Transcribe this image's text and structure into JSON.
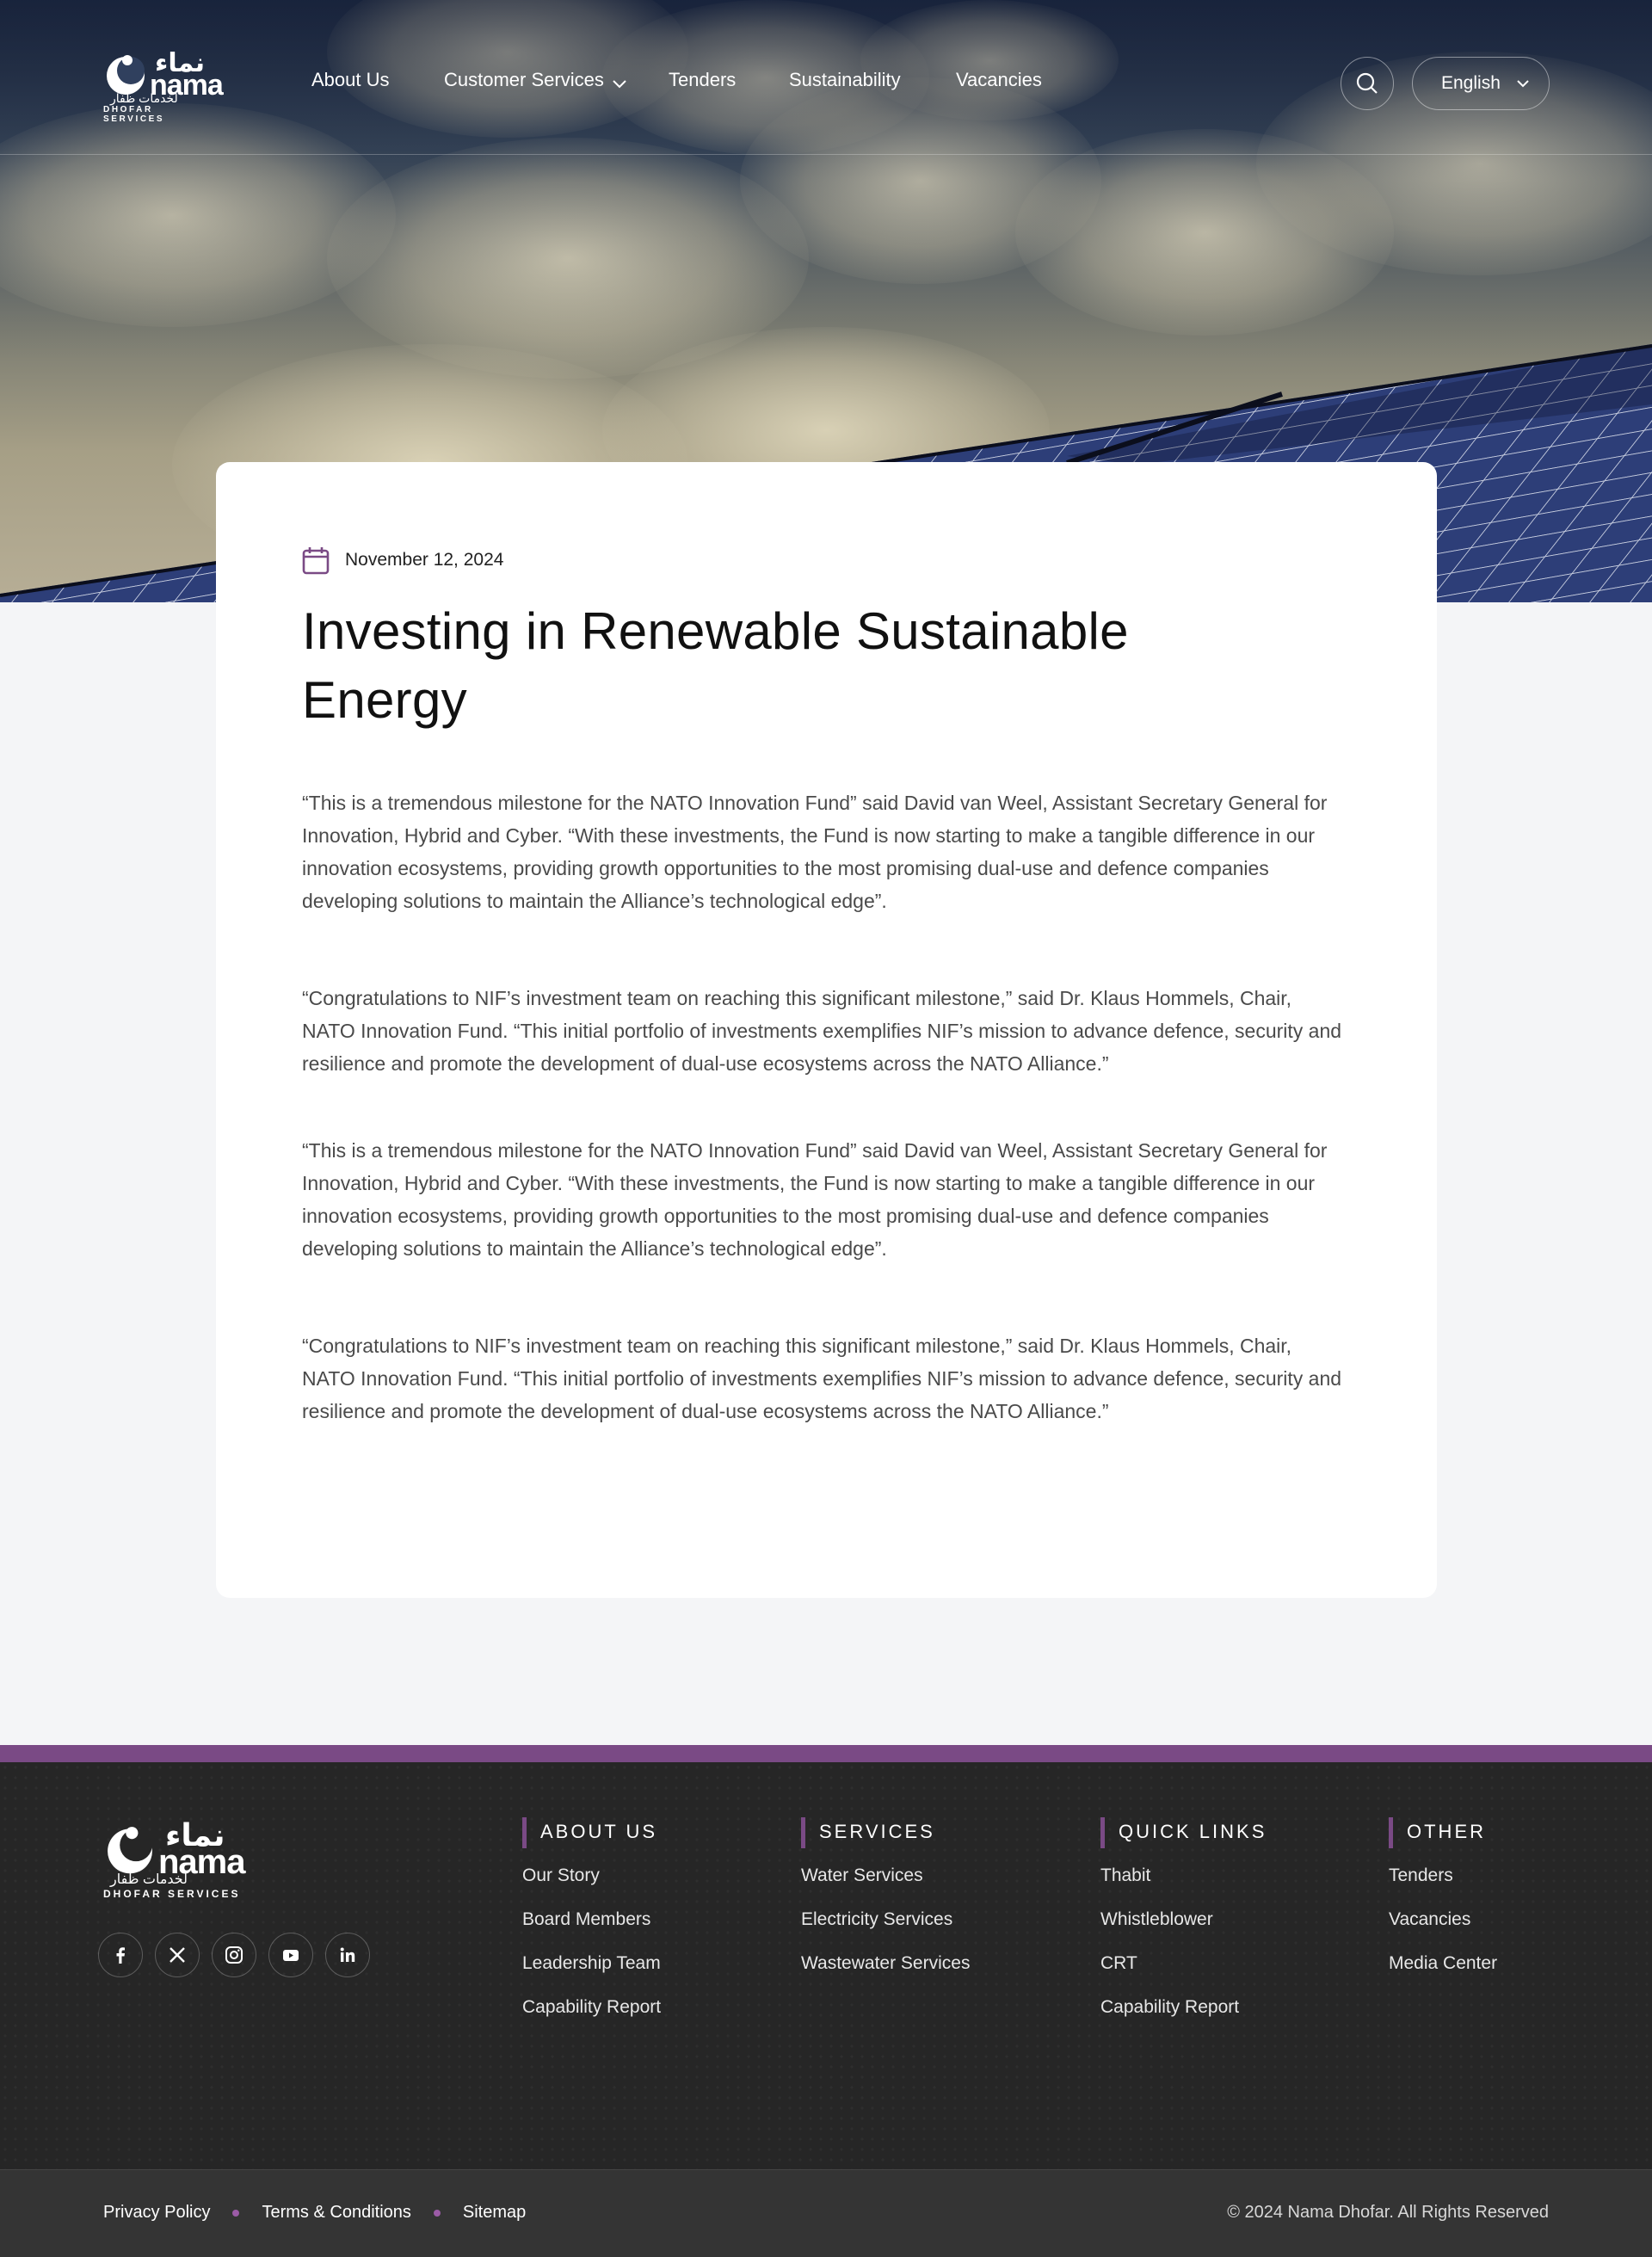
{
  "brand": {
    "name_en": "nama",
    "name_ar": "نماء",
    "tagline_ar": "لخدمات ظفار",
    "tagline_en": "DHOFAR SERVICES"
  },
  "nav": {
    "items": [
      {
        "label": "About Us"
      },
      {
        "label": "Customer Services"
      },
      {
        "label": "Tenders"
      },
      {
        "label": "Sustainability"
      },
      {
        "label": "Vacancies"
      }
    ],
    "language": "English",
    "search_icon": "search-icon"
  },
  "article": {
    "date": "November 12, 2024",
    "title": "Investing in Renewable Sustainable Energy",
    "paragraphs": [
      "“This is a tremendous milestone for the NATO Innovation Fund” said David van Weel, Assistant Secretary General for Innovation, Hybrid and Cyber. “With these investments, the Fund is now starting to make a tangible difference in our innovation ecosystems, providing growth opportunities to the most promising dual-use and defence companies developing solutions to maintain the Alliance’s technological edge”.",
      "“Congratulations to NIF’s investment team on reaching this significant milestone,” said Dr. Klaus Hommels, Chair, NATO Innovation Fund. “This initial portfolio of investments exemplifies NIF’s mission to advance defence, security and resilience and promote the development of dual-use ecosystems across the NATO Alliance.”",
      "“This is a tremendous milestone for the NATO Innovation Fund” said David van Weel, Assistant Secretary General for Innovation, Hybrid and Cyber. “With these investments, the Fund is now starting to make a tangible difference in our innovation ecosystems, providing growth opportunities to the most promising dual-use and defence companies developing solutions to maintain the Alliance’s technological edge”.",
      "“Congratulations to NIF’s investment team on reaching this significant milestone,” said Dr. Klaus Hommels, Chair, NATO Innovation Fund. “This initial portfolio of investments exemplifies NIF’s mission to advance defence, security and resilience and promote the development of dual-use ecosystems across the NATO Alliance.”"
    ]
  },
  "footer": {
    "socials": [
      "facebook-icon",
      "x-icon",
      "instagram-icon",
      "youtube-icon",
      "linkedin-icon"
    ],
    "columns": [
      {
        "heading": "ABOUT US",
        "links": [
          "Our Story",
          "Board Members",
          "Leadership Team",
          "Capability Report"
        ]
      },
      {
        "heading": "SERVICES",
        "links": [
          "Water Services",
          "Electricity Services",
          "Wastewater Services"
        ]
      },
      {
        "heading": "QUICK LINKS",
        "links": [
          "Thabit",
          "Whistleblower",
          "CRT",
          "Capability Report"
        ]
      },
      {
        "heading": "OTHER",
        "links": [
          "Tenders",
          "Vacancies",
          "Media Center"
        ]
      }
    ],
    "bottom_links": [
      "Privacy Policy",
      "Terms & Conditions",
      "Sitemap"
    ],
    "copyright": "© 2024 Nama Dhofar. All Rights Reserved"
  },
  "colors": {
    "accent": "#7a4a85",
    "footer_bg": "#262626",
    "bottom_bar": "#343434"
  }
}
